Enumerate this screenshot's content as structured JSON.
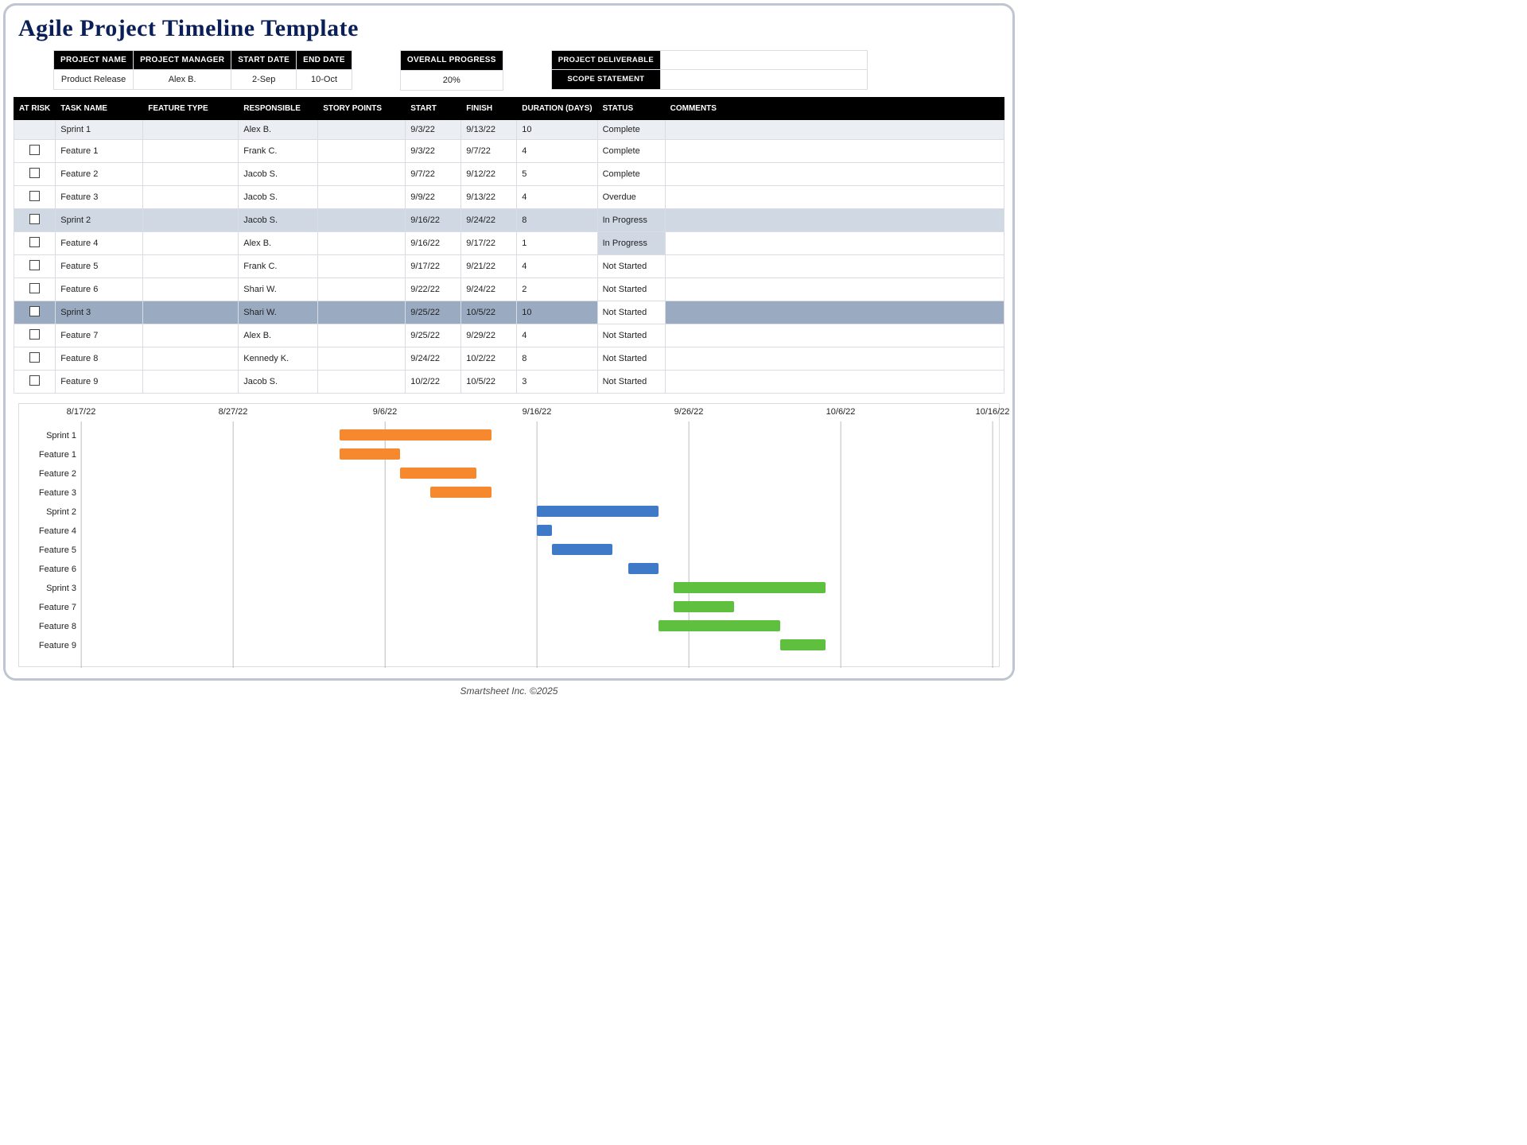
{
  "title": "Agile Project Timeline Template",
  "footer": "Smartsheet Inc. ©2025",
  "summary": {
    "headers": {
      "project_name": "PROJECT NAME",
      "project_manager": "PROJECT MANAGER",
      "start_date": "START DATE",
      "end_date": "END DATE",
      "overall_progress": "OVERALL PROGRESS",
      "project_deliverable": "PROJECT DELIVERABLE",
      "scope_statement": "SCOPE STATEMENT"
    },
    "values": {
      "project_name": "Product Release",
      "project_manager": "Alex B.",
      "start_date": "2-Sep",
      "end_date": "10-Oct",
      "overall_progress": "20%",
      "project_deliverable": "",
      "scope_statement": ""
    }
  },
  "table": {
    "headers": {
      "at_risk": "AT RISK",
      "task_name": "TASK NAME",
      "feature_type": "FEATURE TYPE",
      "responsible": "RESPONSIBLE",
      "story_points": "STORY POINTS",
      "start": "START",
      "finish": "FINISH",
      "duration": "DURATION (DAYS)",
      "status": "STATUS",
      "comments": "COMMENTS"
    },
    "rows": [
      {
        "kind": "sprint",
        "shade": "#ebeef2",
        "task": "Sprint 1",
        "feat": "",
        "resp": "Alex B.",
        "sp": "",
        "start": "9/3/22",
        "finish": "9/13/22",
        "days": "10",
        "status": "Complete",
        "status_bg": "",
        "risk": false,
        "comments": ""
      },
      {
        "kind": "feature",
        "task": "Feature 1",
        "feat": "",
        "resp": "Frank C.",
        "sp": "",
        "start": "9/3/22",
        "finish": "9/7/22",
        "days": "4",
        "status": "Complete",
        "status_bg": "",
        "risk": false,
        "comments": ""
      },
      {
        "kind": "feature",
        "task": "Feature 2",
        "feat": "",
        "resp": "Jacob S.",
        "sp": "",
        "start": "9/7/22",
        "finish": "9/12/22",
        "days": "5",
        "status": "Complete",
        "status_bg": "",
        "risk": false,
        "comments": ""
      },
      {
        "kind": "feature",
        "task": "Feature 3",
        "feat": "",
        "resp": "Jacob S.",
        "sp": "",
        "start": "9/9/22",
        "finish": "9/13/22",
        "days": "4",
        "status": "Overdue",
        "status_bg": "",
        "risk": false,
        "comments": ""
      },
      {
        "kind": "sprint",
        "shade": "#cfd8e3",
        "task": "Sprint 2",
        "feat": "",
        "resp": "Jacob S.",
        "sp": "",
        "start": "9/16/22",
        "finish": "9/24/22",
        "days": "8",
        "status": "In Progress",
        "status_bg": "",
        "risk": false,
        "comments": ""
      },
      {
        "kind": "feature",
        "task": "Feature 4",
        "feat": "",
        "resp": "Alex B.",
        "sp": "",
        "start": "9/16/22",
        "finish": "9/17/22",
        "days": "1",
        "status": "In Progress",
        "status_bg": "#cfd8e3",
        "risk": false,
        "comments": ""
      },
      {
        "kind": "feature",
        "task": "Feature 5",
        "feat": "",
        "resp": "Frank C.",
        "sp": "",
        "start": "9/17/22",
        "finish": "9/21/22",
        "days": "4",
        "status": "Not Started",
        "status_bg": "",
        "risk": false,
        "comments": ""
      },
      {
        "kind": "feature",
        "task": "Feature 6",
        "feat": "",
        "resp": "Shari W.",
        "sp": "",
        "start": "9/22/22",
        "finish": "9/24/22",
        "days": "2",
        "status": "Not Started",
        "status_bg": "",
        "risk": false,
        "comments": ""
      },
      {
        "kind": "sprint",
        "shade": "#9aaac1",
        "task": "Sprint 3",
        "feat": "",
        "resp": "Shari W.",
        "sp": "",
        "start": "9/25/22",
        "finish": "10/5/22",
        "days": "10",
        "status": "Not Started",
        "status_bg": "#ffffff",
        "risk": false,
        "comments": ""
      },
      {
        "kind": "feature",
        "task": "Feature 7",
        "feat": "",
        "resp": "Alex B.",
        "sp": "",
        "start": "9/25/22",
        "finish": "9/29/22",
        "days": "4",
        "status": "Not Started",
        "status_bg": "",
        "risk": false,
        "comments": ""
      },
      {
        "kind": "feature",
        "task": "Feature 8",
        "feat": "",
        "resp": "Kennedy K.",
        "sp": "",
        "start": "9/24/22",
        "finish": "10/2/22",
        "days": "8",
        "status": "Not Started",
        "status_bg": "",
        "risk": false,
        "comments": ""
      },
      {
        "kind": "feature",
        "task": "Feature 9",
        "feat": "",
        "resp": "Jacob S.",
        "sp": "",
        "start": "10/2/22",
        "finish": "10/5/22",
        "days": "3",
        "status": "Not Started",
        "status_bg": "",
        "risk": false,
        "comments": ""
      }
    ]
  },
  "chart_data": {
    "type": "bar",
    "orientation": "horizontal-gantt",
    "x_axis": {
      "min": "8/17/22",
      "max": "10/16/22",
      "ticks": [
        "8/17/22",
        "8/27/22",
        "9/6/22",
        "9/16/22",
        "9/26/22",
        "10/6/22",
        "10/16/22"
      ]
    },
    "color_groups": {
      "sprint1": "#f6892d",
      "sprint2": "#3f7ac9",
      "sprint3": "#5fbf3f"
    },
    "series": [
      {
        "name": "Sprint 1",
        "start": "9/3/22",
        "finish": "9/13/22",
        "group": "sprint1"
      },
      {
        "name": "Feature 1",
        "start": "9/3/22",
        "finish": "9/7/22",
        "group": "sprint1"
      },
      {
        "name": "Feature 2",
        "start": "9/7/22",
        "finish": "9/12/22",
        "group": "sprint1"
      },
      {
        "name": "Feature 3",
        "start": "9/9/22",
        "finish": "9/13/22",
        "group": "sprint1"
      },
      {
        "name": "Sprint 2",
        "start": "9/16/22",
        "finish": "9/24/22",
        "group": "sprint2"
      },
      {
        "name": "Feature 4",
        "start": "9/16/22",
        "finish": "9/17/22",
        "group": "sprint2"
      },
      {
        "name": "Feature 5",
        "start": "9/17/22",
        "finish": "9/21/22",
        "group": "sprint2"
      },
      {
        "name": "Feature 6",
        "start": "9/22/22",
        "finish": "9/24/22",
        "group": "sprint2"
      },
      {
        "name": "Sprint 3",
        "start": "9/25/22",
        "finish": "10/5/22",
        "group": "sprint3"
      },
      {
        "name": "Feature 7",
        "start": "9/25/22",
        "finish": "9/29/22",
        "group": "sprint3"
      },
      {
        "name": "Feature 8",
        "start": "9/24/22",
        "finish": "10/2/22",
        "group": "sprint3"
      },
      {
        "name": "Feature 9",
        "start": "10/2/22",
        "finish": "10/5/22",
        "group": "sprint3"
      }
    ]
  }
}
